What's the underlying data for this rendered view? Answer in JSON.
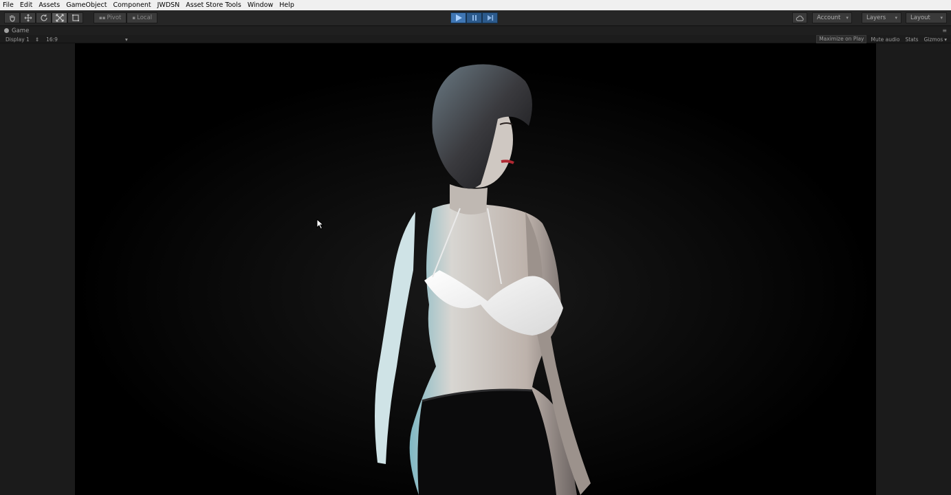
{
  "menubar": {
    "items": [
      "File",
      "Edit",
      "Assets",
      "GameObject",
      "Component",
      "JWDSN",
      "Asset Store Tools",
      "Window",
      "Help"
    ]
  },
  "toolbar": {
    "transform_tools": [
      "hand-icon",
      "move-icon",
      "rotate-icon",
      "scale-icon",
      "rect-icon"
    ],
    "pivot_label": "Pivot",
    "local_label": "Local",
    "playback": [
      "play-icon",
      "pause-icon",
      "step-icon"
    ],
    "cloud_icon": "cloud-icon",
    "account_label": "Account",
    "layers_label": "Layers",
    "layout_label": "Layout"
  },
  "game_tab": {
    "title": "Game",
    "menu_icon": "tab-menu-icon"
  },
  "game_view": {
    "display": "Display 1",
    "aspect": "16:9",
    "maximize_on_play": "Maximize on Play",
    "mute_audio": "Mute audio",
    "stats": "Stats",
    "gizmos": "Gizmos"
  },
  "colors": {
    "toolbar_bg": "#262626",
    "play_active": "#3f76b4",
    "scene_bg": "#000000"
  }
}
